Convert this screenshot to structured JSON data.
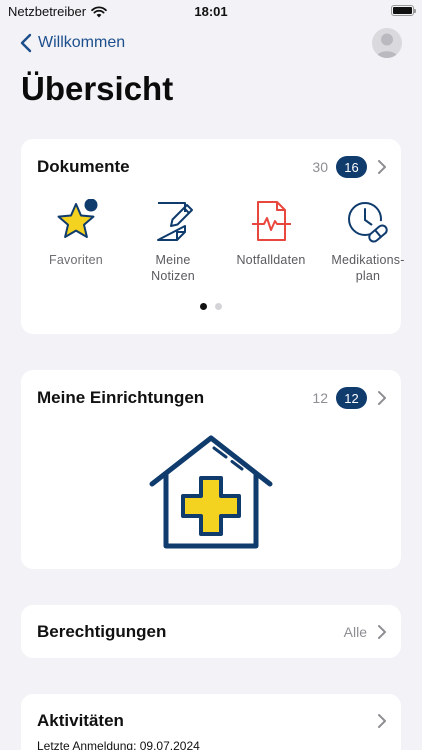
{
  "status_bar": {
    "carrier": "Netzbetreiber",
    "time": "18:01"
  },
  "nav": {
    "back_label": "Willkommen"
  },
  "page": {
    "title": "Übersicht"
  },
  "documents": {
    "title": "Dokumente",
    "total": "30",
    "badge": "16",
    "items": [
      {
        "label": "Favoriten",
        "icon": "star-icon"
      },
      {
        "label": "Meine\nNotizen",
        "icon": "notes-icon"
      },
      {
        "label": "Notfalldaten",
        "icon": "emergency-doc-icon"
      },
      {
        "label": "Medikations-\nplan",
        "icon": "medication-plan-icon"
      }
    ],
    "pages": 2,
    "current_page": 1
  },
  "institutions": {
    "title": "Meine Einrichtungen",
    "total": "12",
    "badge": "12",
    "icon": "medical-house-icon"
  },
  "permissions": {
    "title": "Berechtigungen",
    "value": "Alle"
  },
  "activities": {
    "title": "Aktivitäten",
    "last_login": "Letzte Anmeldung: 09.07.2024"
  },
  "colors": {
    "accent": "#0f3b6d",
    "link": "#1d4f8c",
    "yellow": "#f4d320",
    "red": "#e8473e"
  }
}
